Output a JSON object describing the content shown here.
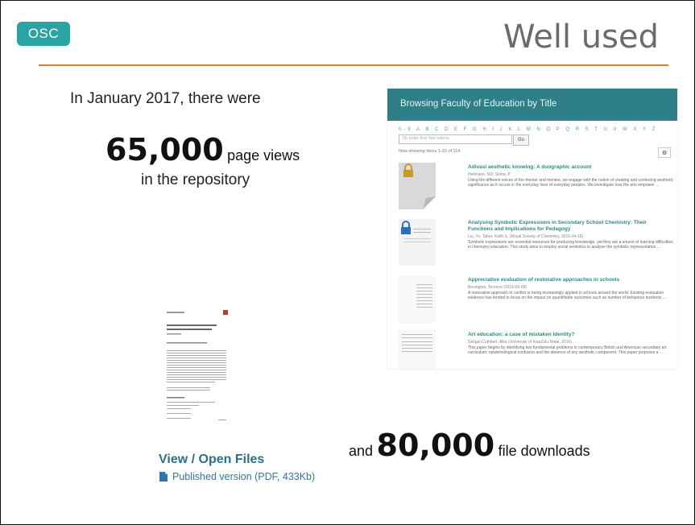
{
  "badge": "OSC",
  "title": "Well used",
  "intro": "In January 2017, there were",
  "stat1": {
    "number": "65,000",
    "unit": "page views",
    "suffix": "in the repository"
  },
  "stat2": {
    "prefix": "and",
    "number": "80,000",
    "unit": "file downloads"
  },
  "colors": {
    "accent": "#2aa3a3",
    "rule": "#e07b2c",
    "header": "#2f7f88",
    "link": "#2f77a9"
  },
  "repo": {
    "header": "Browsing Faculty of Education by Title",
    "alphabet": "0-9 A B C D E F G H I J K L M N O P Q R S T U V W X Y Z",
    "search_placeholder": "Or enter first few letters:",
    "go": "Go",
    "showing": "Now showing items 1-20 of 114",
    "items": [
      {
        "title": "Adivasi aesthetic knowing: A duographic account",
        "authors": "Heilmann, RD; Sinha, P",
        "abstract": "Using the different voices of the mentor and mentee, we engage with the notion of creating and conferring aesthetic significance as it occurs in the everyday lives of everyday peoples. We investigate how the arts empower ..."
      },
      {
        "title": "Analysing Symbolic Expressions in Secondary School Chemistry: Their Functions and Implications for Pedagogy",
        "authors": "Liu, Yu; Taber, Keith S. (Royal Society of Chemistry, 2016-04-18)",
        "abstract": "Symbolic expressions are essential resources for producing knowledge, yet they are a source of learning difficulties in chemistry education. This study aims to employ social semiotics to analyse the symbolic representation ..."
      },
      {
        "title": "Appreciative evaluation of restorative approaches in schools",
        "authors": "Bevington, Terence (2015-06-08)",
        "abstract": "A restorative approach to conflict is being increasingly applied in schools around the world. Existing evaluation evidence has tended to focus on the impact on quantifiable outcomes such as number of behaviour incidents ..."
      },
      {
        "title": "Art education: a case of mistaken identity?",
        "authors": "Sehgal-Cuthbert, Alka (University of KwaZulu-Natal, 2016)",
        "abstract": "This paper begins by identifying two fundamental problems in contemporary British and American secondary art curriculum: epistemological confusion and the absence of any aesthetic component. This paper proposes a ..."
      }
    ]
  },
  "files": {
    "heading": "View / Open Files",
    "link": "Published version (PDF, 433Kb)"
  }
}
